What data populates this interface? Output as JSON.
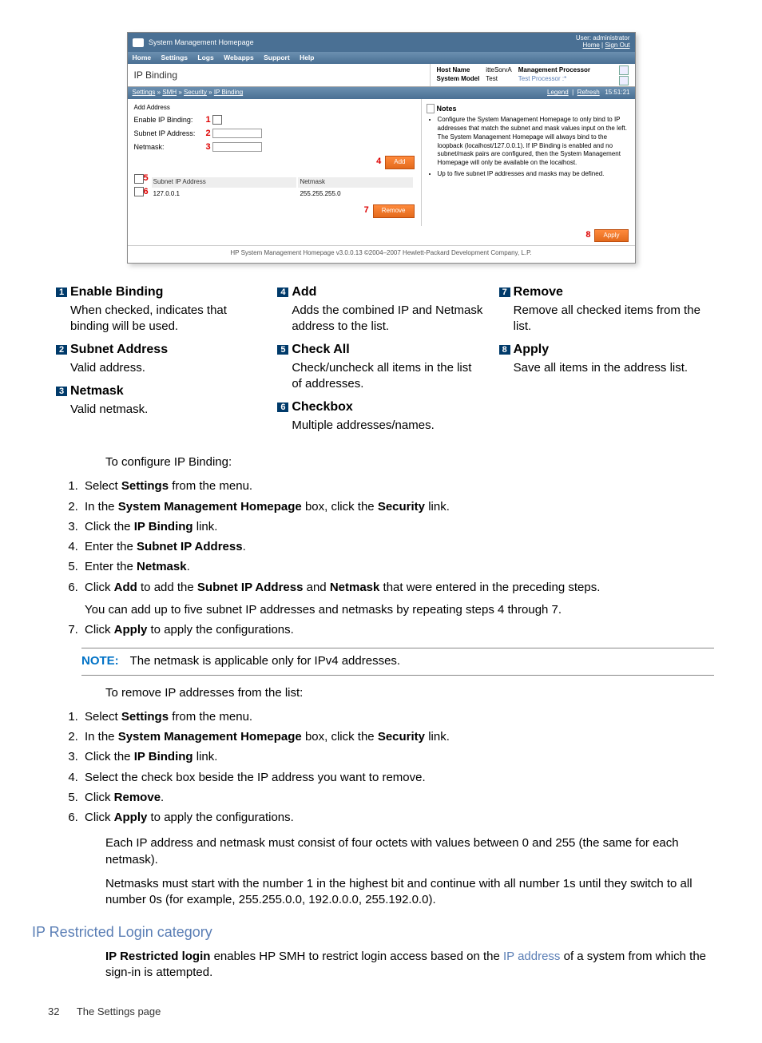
{
  "screenshot": {
    "title": "System Management Homepage",
    "user_label": "User: administrator",
    "home_link": "Home",
    "signout_link": "Sign Out",
    "menu": [
      "Home",
      "Settings",
      "Logs",
      "Webapps",
      "Support",
      "Help"
    ],
    "page_title": "IP Binding",
    "host_name_l": "Host Name",
    "host_name_v": "itteSorvA",
    "sys_model_l": "System Model",
    "sys_model_v": "Test",
    "mp_label": "Management Processor",
    "mp_value": "Test Processor :*",
    "breadcrumb": [
      "Settings",
      "SMH",
      "Security",
      "IP Binding"
    ],
    "legend_link": "Legend",
    "refresh_link": "Refresh",
    "time": "15:51:21",
    "add_header": "Add Address",
    "enable_label": "Enable IP Binding:",
    "subnet_label": "Subnet IP Address:",
    "netmask_label": "Netmask:",
    "add_btn": "Add",
    "table_h1": "Subnet IP Address",
    "table_h2": "Netmask",
    "row_ip": "127.0.0.1",
    "row_mask": "255.255.255.0",
    "remove_btn": "Remove",
    "apply_btn": "Apply",
    "notes_h": "Notes",
    "note1": "Configure the System Management Homepage to only bind to IP addresses that match the subnet and mask values input on the left. The System Management Homepage will always bind to the loopback (localhost/127.0.0.1). If IP Binding is enabled and no subnet/mask pairs are configured, then the System Management Homepage will only be available on the localhost.",
    "note2": "Up to five subnet IP addresses and masks may be defined.",
    "footer": "HP System Management Homepage v3.0.0.13    ©2004–2007 Hewlett-Packard Development Company, L.P.",
    "callouts": {
      "c1": "1",
      "c2": "2",
      "c3": "3",
      "c4": "4",
      "c5": "5",
      "c6": "6",
      "c7": "7",
      "c8": "8"
    }
  },
  "legend": {
    "i1": {
      "t": "Enable Binding",
      "d": "When checked, indicates that binding will be used."
    },
    "i2": {
      "t": "Subnet Address",
      "d": "Valid address."
    },
    "i3": {
      "t": "Netmask",
      "d": "Valid netmask."
    },
    "i4": {
      "t": "Add",
      "d": "Adds the combined IP and Netmask address to the list."
    },
    "i5": {
      "t": "Check All",
      "d": "Check/uncheck all items in the list of addresses."
    },
    "i6": {
      "t": "Checkbox",
      "d": "Multiple addresses/names."
    },
    "i7": {
      "t": "Remove",
      "d": "Remove all checked items from the list."
    },
    "i8": {
      "t": "Apply",
      "d": "Save all items in the address list."
    }
  },
  "body": {
    "cfg_intro": "To configure IP Binding:",
    "cfg1a": "Select ",
    "cfg1b": "Settings",
    "cfg1c": " from the menu.",
    "cfg2a": "In the ",
    "cfg2b": "System Management Homepage",
    "cfg2c": " box, click the ",
    "cfg2d": "Security",
    "cfg2e": " link.",
    "cfg3a": "Click the ",
    "cfg3b": "IP Binding",
    "cfg3c": " link.",
    "cfg4a": "Enter the ",
    "cfg4b": "Subnet IP Address",
    "cfg4c": ".",
    "cfg5a": "Enter the ",
    "cfg5b": "Netmask",
    "cfg5c": ".",
    "cfg6a": "Click ",
    "cfg6b": "Add",
    "cfg6c": " to add the ",
    "cfg6d": "Subnet IP Address",
    "cfg6e": " and ",
    "cfg6f": "Netmask",
    "cfg6g": " that were entered in the preceding steps.",
    "cfg6_extra": "You can add up to five subnet IP addresses and netmasks by repeating steps 4 through 7.",
    "cfg7a": "Click ",
    "cfg7b": "Apply",
    "cfg7c": " to apply the configurations.",
    "note_label": "NOTE:",
    "note_text": "The netmask is applicable only for IPv4 addresses.",
    "rm_intro": "To remove IP addresses from the list:",
    "rm1a": "Select ",
    "rm1b": "Settings",
    "rm1c": " from the menu.",
    "rm4": "Select the check box beside the IP address you want to remove.",
    "rm5a": "Click ",
    "rm5b": "Remove",
    "rm5c": ".",
    "rm6a": "Click ",
    "rm6b": "Apply",
    "rm6c": " to apply the configurations.",
    "p_octets": "Each IP address and netmask must consist of four octets with values between 0 and 255 (the same for each netmask).",
    "p_netmasks": "Netmasks must start with the number 1 in the highest bit and continue with all number 1s until they switch to all number 0s (for example, 255.255.0.0, 192.0.0.0, 255.192.0.0).",
    "section": "IP Restricted Login category",
    "sec_p1a": "IP Restricted login",
    "sec_p1b": " enables HP SMH to restrict login access based on the ",
    "sec_p1c": "IP address",
    "sec_p1d": " of a system from which the sign-in is attempted.",
    "page_num": "32",
    "page_label": "The Settings page"
  }
}
